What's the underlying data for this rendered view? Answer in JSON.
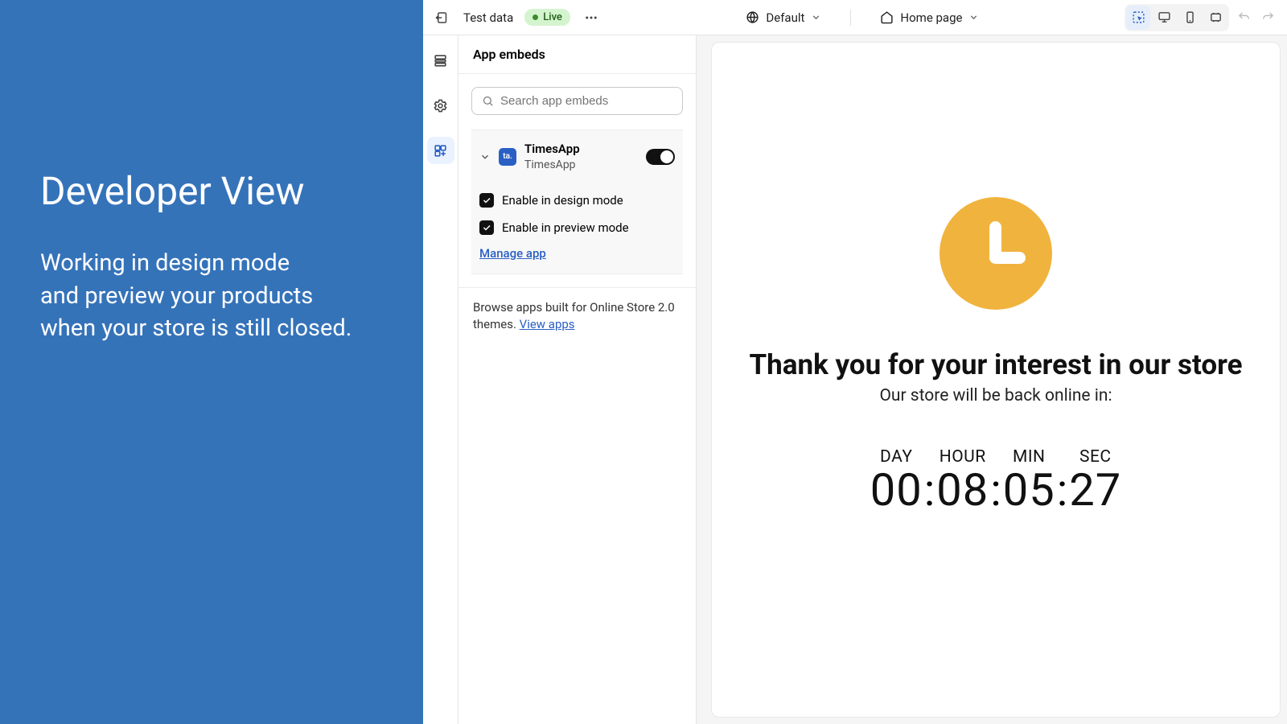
{
  "promo": {
    "title": "Developer View",
    "line1": "Working in design mode",
    "line2": "and preview your products",
    "line3": "when your store is still closed."
  },
  "topbar": {
    "data_label": "Test data",
    "badge_label": "Live",
    "default_label": "Default",
    "page_label": "Home page"
  },
  "panel": {
    "title": "App embeds",
    "search_placeholder": "Search app embeds",
    "app_name": "TimesApp",
    "app_sub": "TimesApp",
    "app_logo_text": "ta.",
    "opt_design": "Enable in design mode",
    "opt_preview": "Enable in preview mode",
    "manage_link": "Manage app",
    "browse_prefix": "Browse apps built for Online Store 2.0 themes. ",
    "browse_link": "View apps"
  },
  "preview": {
    "headline": "Thank you for your interest in our store",
    "subline": "Our store will be back online in:",
    "units": [
      "DAY",
      "HOUR",
      "MIN",
      "SEC"
    ],
    "values": [
      "00",
      "08",
      "05",
      "27"
    ]
  },
  "colors": {
    "accent_blue": "#3573b9",
    "clock_gold": "#f0b33d",
    "link_blue": "#2a5fc4"
  }
}
